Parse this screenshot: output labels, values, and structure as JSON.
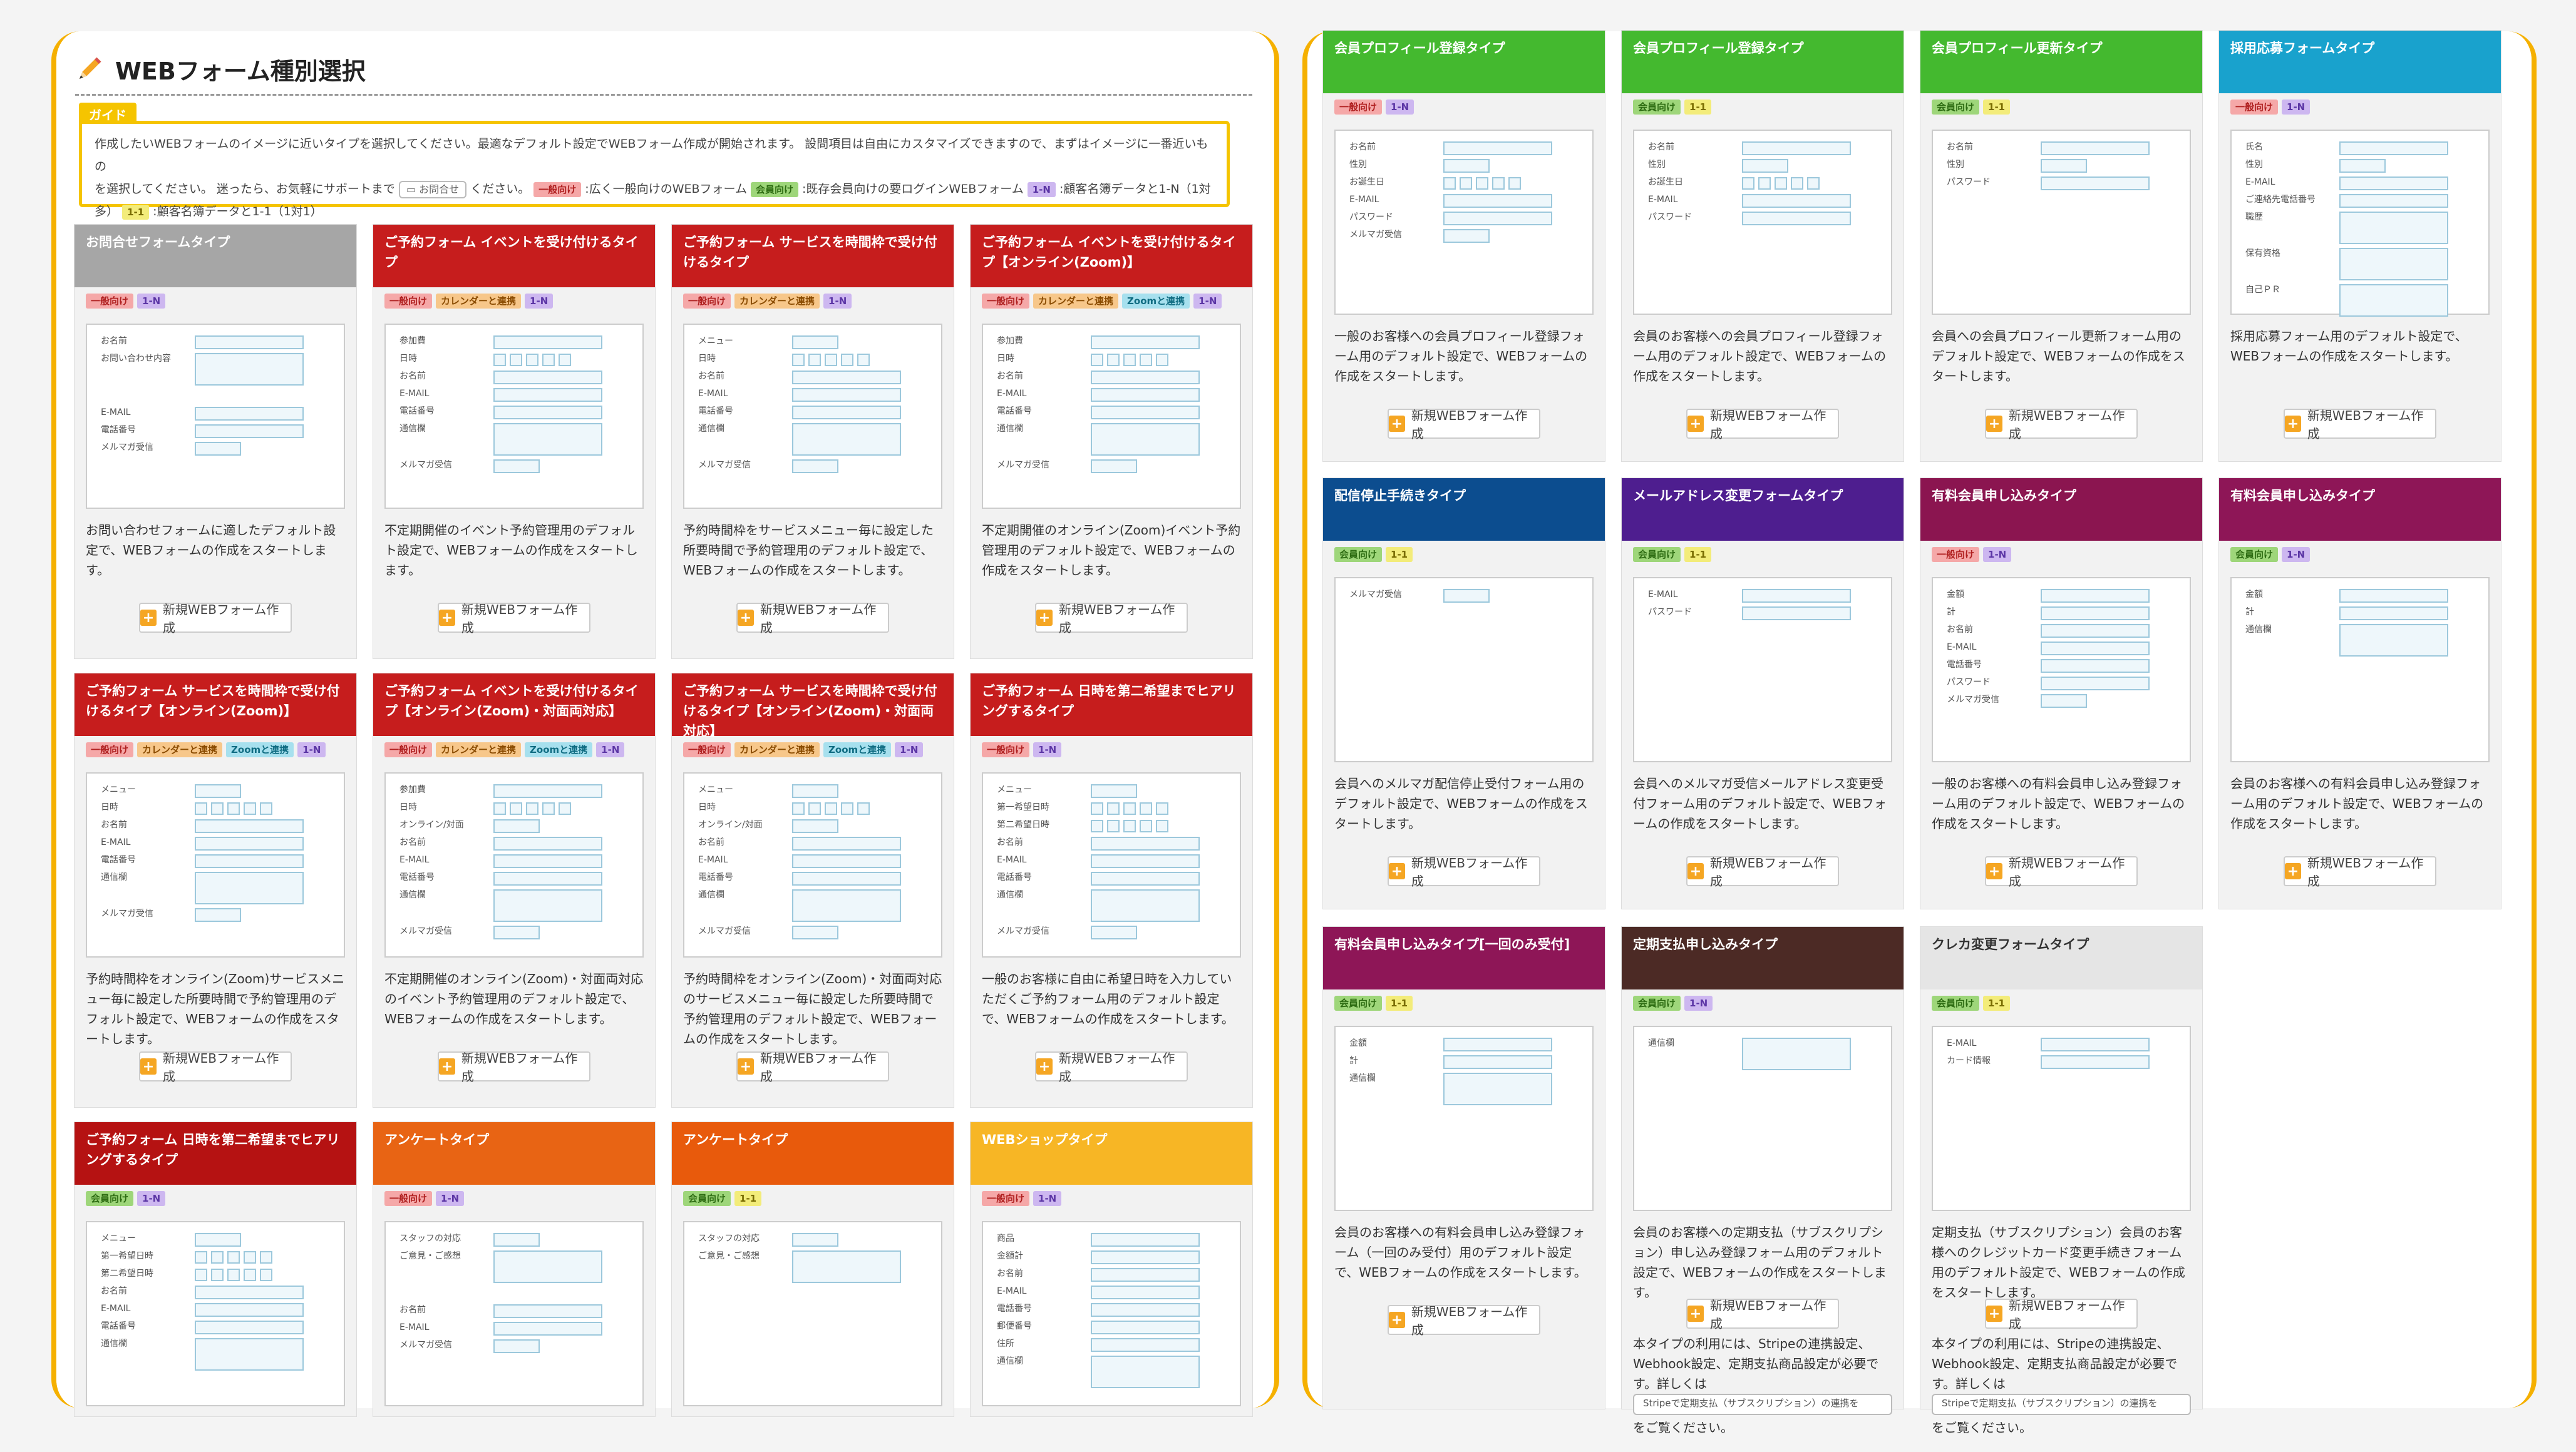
{
  "header": {
    "title": "WEBフォーム種別選択"
  },
  "guide": {
    "tab": "ガイド",
    "line1": "作成したいWEBフォームのイメージに近いタイプを選択してください。最適なデフォルト設定でWEBフォーム作成が開始されます。 設問項目は自由にカスタマイズできますので、まずはイメージに一番近いもの",
    "line2_a": "を選択してください。 迷ったら、お気軽にサポートまで",
    "inquiry_button": "お問合せ",
    "line2_b": "ください。",
    "tag_ippan": "一般向け",
    "desc_ippan": ":広く一般向けのWEBフォーム",
    "tag_kaiin": "会員向け",
    "desc_kaiin": ":既存会員向けの要ログインWEBフォーム",
    "tag_n": "1-N",
    "desc_n": ":顧客名簿データと1-N（1対",
    "line3_a": "多）",
    "tag_one": "1-1",
    "desc_one": ":顧客名簿データと1-1（1対1）"
  },
  "labels": {
    "new_button": "新規WEBフォーム作成",
    "stripe_link": "Stripeで定期支払（サブスクリプション）の連携を"
  },
  "cards": [
    {
      "title": "お問合せフォームタイプ",
      "color": "#a6a6a6",
      "tags": [
        "一般向け",
        "1-N"
      ],
      "fields": [
        "お名前",
        "お問い合わせ内容",
        "",
        "E-MAIL",
        "電話番号",
        "メルマガ受信"
      ],
      "desc": "お問い合わせフォームに適したデフォルト設定で、WEBフォームの作成をスタートします。"
    },
    {
      "title": "ご予約フォーム イベントを受け付けるタイプ",
      "color": "#c61d1d",
      "tags": [
        "一般向け",
        "カレンダーと連携",
        "1-N"
      ],
      "fields": [
        "参加費",
        "日時",
        "お名前",
        "E-MAIL",
        "電話番号",
        "通信欄",
        "メルマガ受信"
      ],
      "desc": "不定期開催のイベント予約管理用のデフォルト設定で、WEBフォームの作成をスタートします。"
    },
    {
      "title": "ご予約フォーム サービスを時間枠で受け付けるタイプ",
      "color": "#c61d1d",
      "tags": [
        "一般向け",
        "カレンダーと連携",
        "1-N"
      ],
      "fields": [
        "メニュー",
        "日時",
        "お名前",
        "E-MAIL",
        "電話番号",
        "通信欄",
        "メルマガ受信"
      ],
      "desc": "予約時間枠をサービスメニュー毎に設定した所要時間で予約管理用のデフォルト設定で、WEBフォームの作成をスタートします。"
    },
    {
      "title": "ご予約フォーム イベントを受け付けるタイプ【オンライン(Zoom)】",
      "color": "#c61d1d",
      "tags": [
        "一般向け",
        "カレンダーと連携",
        "Zoomと連携",
        "1-N"
      ],
      "fields": [
        "参加費",
        "日時",
        "お名前",
        "E-MAIL",
        "電話番号",
        "通信欄",
        "メルマガ受信"
      ],
      "desc": "不定期開催のオンライン(Zoom)イベント予約管理用のデフォルト設定で、WEBフォームの作成をスタートします。"
    },
    {
      "title": "ご予約フォーム サービスを時間枠で受け付けるタイプ【オンライン(Zoom)】",
      "color": "#c61d1d",
      "tags": [
        "一般向け",
        "カレンダーと連携",
        "Zoomと連携",
        "1-N"
      ],
      "fields": [
        "メニュー",
        "日時",
        "お名前",
        "E-MAIL",
        "電話番号",
        "通信欄",
        "メルマガ受信"
      ],
      "desc": "予約時間枠をオンライン(Zoom)サービスメニュー毎に設定した所要時間で予約管理用のデフォルト設定で、WEBフォームの作成をスタートします。"
    },
    {
      "title": "ご予約フォーム イベントを受け付けるタイプ【オンライン(Zoom)・対面両対応】",
      "color": "#c61d1d",
      "tags": [
        "一般向け",
        "カレンダーと連携",
        "Zoomと連携",
        "1-N"
      ],
      "fields": [
        "参加費",
        "日時",
        "オンライン/対面",
        "お名前",
        "E-MAIL",
        "電話番号",
        "通信欄",
        "メルマガ受信"
      ],
      "desc": "不定期開催のオンライン(Zoom)・対面両対応のイベント予約管理用のデフォルト設定で、WEBフォームの作成をスタートします。"
    },
    {
      "title": "ご予約フォーム サービスを時間枠で受け付けるタイプ【オンライン(Zoom)・対面両対応】",
      "color": "#c61d1d",
      "tags": [
        "一般向け",
        "カレンダーと連携",
        "Zoomと連携",
        "1-N"
      ],
      "fields": [
        "メニュー",
        "日時",
        "オンライン/対面",
        "お名前",
        "E-MAIL",
        "電話番号",
        "通信欄",
        "メルマガ受信"
      ],
      "desc": "予約時間枠をオンライン(Zoom)・対面両対応のサービスメニュー毎に設定した所要時間で予約管理用のデフォルト設定で、WEBフォームの作成をスタートします。"
    },
    {
      "title": "ご予約フォーム 日時を第二希望までヒアリングするタイプ",
      "color": "#c61d1d",
      "tags": [
        "一般向け",
        "1-N"
      ],
      "fields": [
        "メニュー",
        "第一希望日時",
        "第二希望日時",
        "お名前",
        "E-MAIL",
        "電話番号",
        "通信欄",
        "メルマガ受信"
      ],
      "desc": "一般のお客様に自由に希望日時を入力していただくご予約フォーム用のデフォルト設定で、WEBフォームの作成をスタートします。"
    },
    {
      "title": "ご予約フォーム 日時を第二希望までヒアリングするタイプ",
      "color": "#b51212",
      "tags": [
        "会員向け",
        "1-N"
      ],
      "fields": [
        "メニュー",
        "第一希望日時",
        "第二希望日時",
        "お名前",
        "E-MAIL",
        "電話番号",
        "通信欄"
      ],
      "desc": ""
    },
    {
      "title": "アンケートタイプ",
      "color": "#e86414",
      "tags": [
        "一般向け",
        "1-N"
      ],
      "fields": [
        "スタッフの対応",
        "ご意見・ご感想",
        "",
        "お名前",
        "E-MAIL",
        "メルマガ受信"
      ],
      "desc": ""
    },
    {
      "title": "アンケートタイプ",
      "color": "#e85a0c",
      "tags": [
        "会員向け",
        "1-1"
      ],
      "fields": [
        "スタッフの対応",
        "ご意見・ご感想"
      ],
      "desc": ""
    },
    {
      "title": "WEBショップタイプ",
      "color": "#f7b625",
      "tags": [
        "一般向け",
        "1-N"
      ],
      "fields": [
        "商品",
        "金額計",
        "お名前",
        "E-MAIL",
        "電話番号",
        "郵便番号",
        "住所",
        "通信欄"
      ],
      "desc": ""
    },
    {
      "title": "会員プロフィール登録タイプ",
      "color": "#44b92f",
      "tags": [
        "一般向け",
        "1-N"
      ],
      "fields": [
        "お名前",
        "性別",
        "お誕生日",
        "E-MAIL",
        "パスワード",
        "メルマガ受信"
      ],
      "desc": "一般のお客様への会員プロフィール登録フォーム用のデフォルト設定で、WEBフォームの作成をスタートします。"
    },
    {
      "title": "会員プロフィール登録タイプ",
      "color": "#44b92f",
      "tags": [
        "会員向け",
        "1-1"
      ],
      "fields": [
        "お名前",
        "性別",
        "お誕生日",
        "E-MAIL",
        "パスワード"
      ],
      "desc": "会員のお客様への会員プロフィール登録フォーム用のデフォルト設定で、WEBフォームの作成をスタートします。"
    },
    {
      "title": "会員プロフィール更新タイプ",
      "color": "#44b92f",
      "tags": [
        "会員向け",
        "1-1"
      ],
      "fields": [
        "お名前",
        "性別",
        "パスワード"
      ],
      "desc": "会員への会員プロフィール更新フォーム用のデフォルト設定で、WEBフォームの作成をスタートします。"
    },
    {
      "title": "採用応募フォームタイプ",
      "color": "#19a2cd",
      "tags": [
        "一般向け",
        "1-N"
      ],
      "fields": [
        "氏名",
        "性別",
        "E-MAIL",
        "ご連絡先電話番号",
        "職歴",
        "保有資格",
        "自己ＰＲ"
      ],
      "desc": "採用応募フォーム用のデフォルト設定で、WEBフォームの作成をスタートします。"
    },
    {
      "title": "配信停止手続きタイプ",
      "color": "#0c4d8f",
      "tags": [
        "会員向け",
        "1-1"
      ],
      "fields": [
        "メルマガ受信"
      ],
      "desc": "会員へのメルマガ配信停止受付フォーム用のデフォルト設定で、WEBフォームの作成をスタートします。"
    },
    {
      "title": "メールアドレス変更フォームタイプ",
      "color": "#4e1e8f",
      "tags": [
        "会員向け",
        "1-1"
      ],
      "fields": [
        "E-MAIL",
        "パスワード"
      ],
      "desc": "会員へのメルマガ受信メールアドレス変更受付フォーム用のデフォルト設定で、WEBフォームの作成をスタートします。"
    },
    {
      "title": "有料会員申し込みタイプ",
      "color": "#8b1550",
      "tags": [
        "一般向け",
        "1-N"
      ],
      "fields": [
        "金額",
        "計",
        "お名前",
        "E-MAIL",
        "電話番号",
        "パスワード",
        "メルマガ受信"
      ],
      "desc": "一般のお客様への有料会員申し込み登録フォーム用のデフォルト設定で、WEBフォームの作成をスタートします。"
    },
    {
      "title": "有料会員申し込みタイプ",
      "color": "#8e1657",
      "tags": [
        "会員向け",
        "1-N"
      ],
      "fields": [
        "金額",
        "計",
        "通信欄"
      ],
      "desc": "会員のお客様への有料会員申し込み登録フォーム用のデフォルト設定で、WEBフォームの作成をスタートします。"
    },
    {
      "title": "有料会員申し込みタイプ[一回のみ受付]",
      "color": "#8e1657",
      "tags": [
        "会員向け",
        "1-1"
      ],
      "fields": [
        "金額",
        "計",
        "通信欄"
      ],
      "desc": "会員のお客様への有料会員申し込み登録フォーム（一回のみ受付）用のデフォルト設定で、WEBフォームの作成をスタートします。"
    },
    {
      "title": "定期支払申し込みタイプ",
      "color": "#4c2a25",
      "tags": [
        "会員向け",
        "1-N"
      ],
      "fields": [
        "通信欄"
      ],
      "desc": "会員のお客様への定期支払（サブスクリプション）申し込み登録フォーム用のデフォルト設定で、WEBフォームの作成をスタートします。",
      "note": "本タイプの利用には、Stripeの連携設定、Webhook設定、定期支払商品設定が必要です。詳しくは",
      "note_tail": "をご覧ください。"
    },
    {
      "title": "クレカ変更フォームタイプ",
      "color": "#e5e5e5",
      "tags": [
        "会員向け",
        "1-1"
      ],
      "fields": [
        "E-MAIL",
        "カード情報"
      ],
      "desc": "定期支払（サブスクリプション）会員のお客様へのクレジットカード変更手続きフォーム用のデフォルト設定で、WEBフォームの作成をスタートします。",
      "note": "本タイプの利用には、Stripeの連携設定、Webhook設定、定期支払商品設定が必要です。詳しくは",
      "note_tail": "をご覧ください。"
    }
  ]
}
